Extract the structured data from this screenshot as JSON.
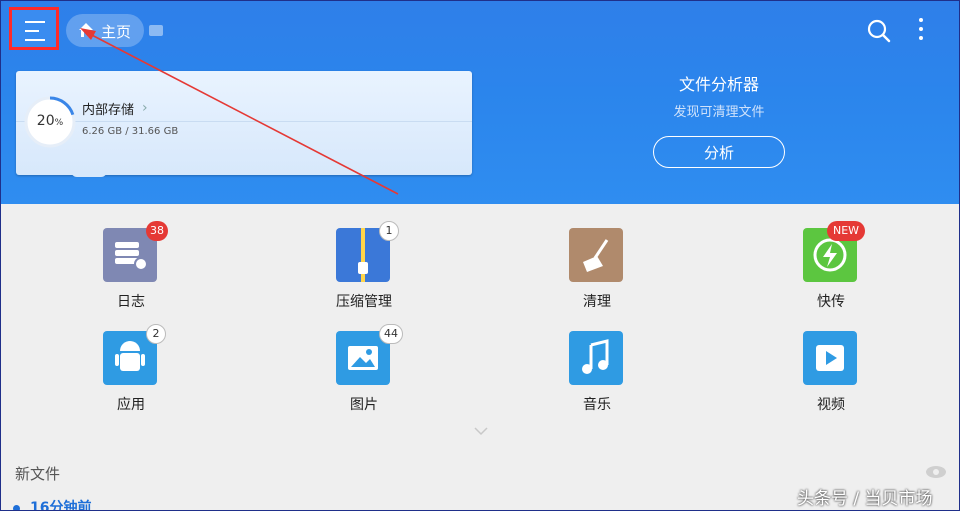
{
  "header": {
    "breadcrumb_home": "主页",
    "accent": "#2f85ec",
    "menu_highlight_color": "#ff2a2a"
  },
  "storage": {
    "percent_label": "20",
    "percent_unit": "%",
    "used_fraction": 0.2,
    "name": "内部存储",
    "size": "6.26 GB / 31.66 GB"
  },
  "analyzer": {
    "title": "文件分析器",
    "subtitle": "发现可清理文件",
    "button": "分析"
  },
  "tiles": [
    {
      "label": "日志",
      "badge": "38",
      "icon": "log-stack-icon",
      "color": "#7f88b3"
    },
    {
      "label": "压缩管理",
      "badge": "1",
      "icon": "zip-archive-icon",
      "color": "#3b78d8"
    },
    {
      "label": "清理",
      "badge": "",
      "icon": "broom-icon",
      "color": "#b08a6c"
    },
    {
      "label": "快传",
      "badge": "NEW",
      "icon": "fast-transfer-icon",
      "color": "#5cc640"
    },
    {
      "label": "应用",
      "badge": "2",
      "icon": "android-icon",
      "color": "#2f9be3"
    },
    {
      "label": "图片",
      "badge": "44",
      "icon": "image-icon",
      "color": "#2f9be3"
    },
    {
      "label": "音乐",
      "badge": "",
      "icon": "music-note-icon",
      "color": "#2f9be3"
    },
    {
      "label": "视频",
      "badge": "",
      "icon": "video-play-icon",
      "color": "#2f9be3"
    }
  ],
  "new_files": {
    "title": "新文件",
    "time_group": "16分钟前"
  },
  "watermark": "头条号 / 当贝市场"
}
